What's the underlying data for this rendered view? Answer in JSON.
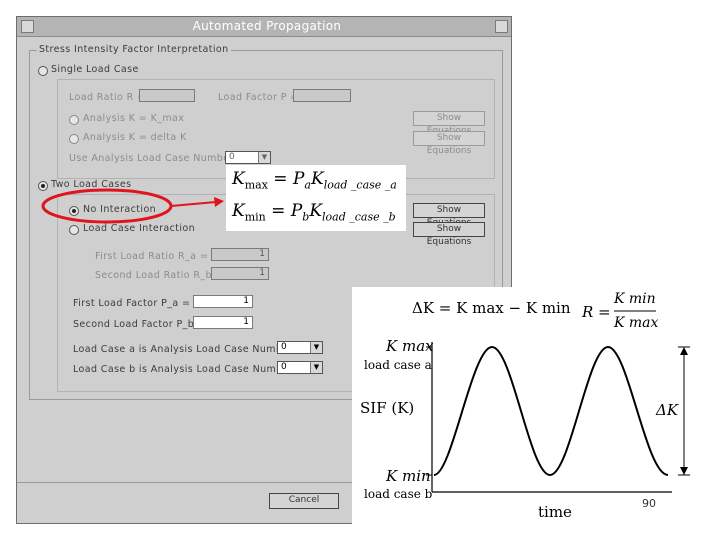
{
  "window": {
    "title": "Automated Propagation"
  },
  "dialog": {
    "group_title": "Stress Intensity Factor Interpretation",
    "single_load_case": "Single Load Case",
    "load_ratio_label": "Load Ratio R =",
    "load_factor_label": "Load Factor P =",
    "analysis_kmax": "Analysis K = K_max",
    "analysis_deltak": "Analysis K = delta K",
    "use_analysis_label": "Use Analysis Load Case Number =",
    "use_analysis_value": "0",
    "two_load_cases": "Two Load Cases",
    "no_interaction": "No Interaction",
    "load_case_interaction": "Load Case Interaction",
    "first_load_ratio_label": "First Load Ratio R_a =",
    "first_load_ratio_value": "1",
    "second_load_ratio_label": "Second Load Ratio R_b =",
    "second_load_ratio_value": "1",
    "first_load_factor_label": "First Load Factor P_a =",
    "first_load_factor_value": "1",
    "second_load_factor_label": "Second Load Factor P_b =",
    "second_load_factor_value": "1",
    "case_a_label": "Load Case a is Analysis Load Case Number =",
    "case_a_value": "0",
    "case_b_label": "Load Case b is Analysis Load Case Number =",
    "case_b_value": "0",
    "show_equations": "Show Equations",
    "cancel": "Cancel"
  },
  "equations": {
    "kmax_lhs": "K",
    "kmax_sub": "max",
    "kmax_rhs_p": "P",
    "kmax_rhs_p_sub": "a",
    "kmax_rhs_k": "K",
    "kmax_rhs_k_sub": "load _case _a",
    "kmin_lhs": "K",
    "kmin_sub": "min",
    "kmin_rhs_p": "P",
    "kmin_rhs_p_sub": "b",
    "kmin_rhs_k": "K",
    "kmin_rhs_k_sub": "load _case _b"
  },
  "plot": {
    "delta_k_eq": "ΔK = K max − K min",
    "r_eq_lhs": "R =",
    "r_num": "K min",
    "r_den": "K max",
    "kmax_label": "K max",
    "kmax_sub_label": "load case a",
    "kmin_label": "K min",
    "kmin_sub_label": "load case b",
    "ylabel": "SIF (K)",
    "xlabel": "time",
    "delta_k_label": "ΔK",
    "corner_number": "90"
  },
  "colors": {
    "highlight_ellipse": "#e0141e",
    "window_bg": "#cfcfcf",
    "titlebar_bg": "#b4b4b4"
  }
}
